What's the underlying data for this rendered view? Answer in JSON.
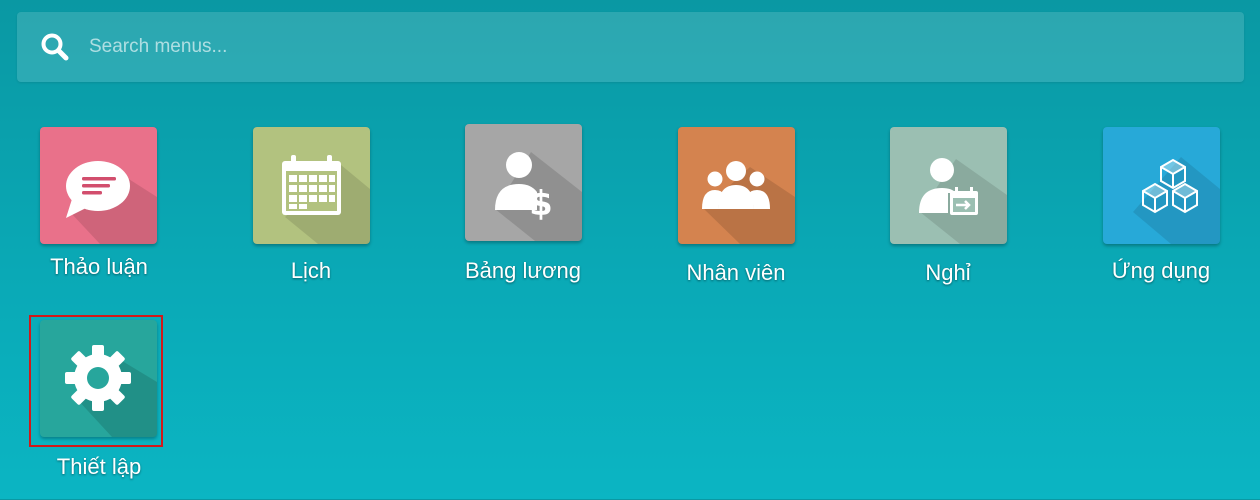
{
  "search": {
    "placeholder": "Search menus...",
    "icon": "search-icon"
  },
  "apps": [
    {
      "label": "Thảo luận",
      "icon": "chat-bubble-icon",
      "color": "#e9718a"
    },
    {
      "label": "Lịch",
      "icon": "calendar-icon",
      "color": "#b2c27f"
    },
    {
      "label": "Bảng lương",
      "icon": "payroll-user-dollar-icon",
      "color": "#a6a6a6"
    },
    {
      "label": "Nhân viên",
      "icon": "employees-group-icon",
      "color": "#d4834f"
    },
    {
      "label": "Nghỉ",
      "icon": "leave-user-calendar-icon",
      "color": "#9bbfb2"
    },
    {
      "label": "Ứng dụng",
      "icon": "apps-cubes-icon",
      "color": "#27a9d8"
    },
    {
      "label": "Thiết lập",
      "icon": "gear-icon",
      "color": "#27a69c"
    }
  ],
  "colors": {
    "background": "#0aa9b6",
    "highlight_border": "#d2191a"
  }
}
